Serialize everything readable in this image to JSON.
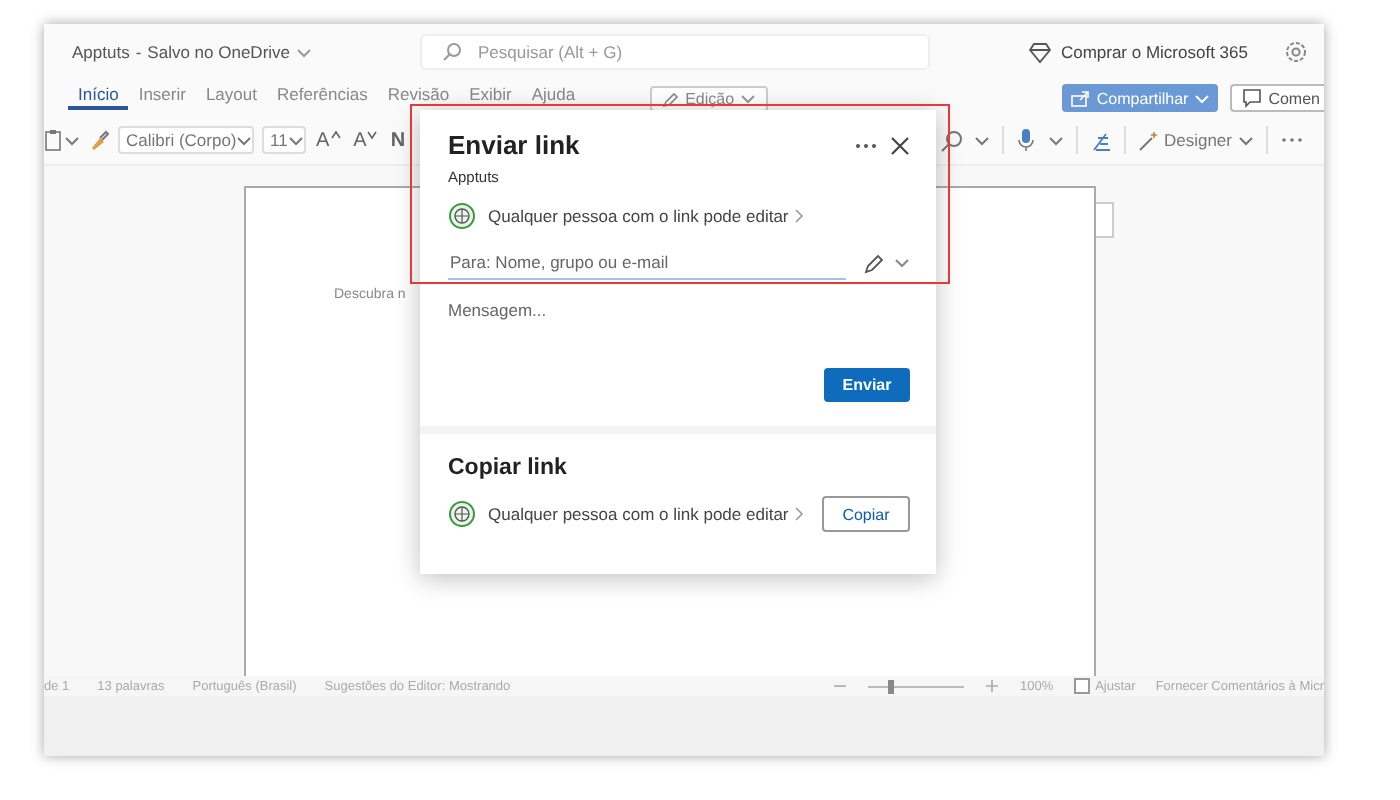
{
  "title_bar": {
    "document": "Apptuts",
    "separator": "-",
    "save_status": "Salvo no OneDrive",
    "search": {
      "placeholder": "Pesquisar (Alt + G)"
    },
    "buy": "Comprar o Microsoft 365"
  },
  "ribbon_tabs": [
    {
      "label": "Início",
      "selected": true
    },
    {
      "label": "Inserir",
      "selected": false
    },
    {
      "label": "Layout",
      "selected": false
    },
    {
      "label": "Referências",
      "selected": false
    },
    {
      "label": "Revisão",
      "selected": false
    },
    {
      "label": "Exibir",
      "selected": false
    },
    {
      "label": "Ajuda",
      "selected": false
    }
  ],
  "editing_mode": "Edição",
  "share_button": "Compartilhar",
  "comments_button": "Comen",
  "toolbar": {
    "font": "Calibri (Corpo)",
    "size": "11",
    "grow_font": "A",
    "shrink_font": "A",
    "bold": "N",
    "designer": "Designer"
  },
  "document": {
    "text": "Descubra n"
  },
  "status_bar": {
    "page": "de 1",
    "words": "13 palavras",
    "language": "Português (Brasil)",
    "editor": "Sugestões do Editor: Mostrando",
    "zoom": {
      "level": 0.2
    },
    "zoom_reading": "100%",
    "fit": {
      "label": "Ajustar",
      "checked": false
    },
    "feedback": "Fornecer Comentários à Micr"
  },
  "dialog": {
    "title": "Enviar link",
    "subtitle": "Apptuts",
    "permission": "Qualquer pessoa com o link pode editar",
    "to_field": {
      "placeholder": "Para: Nome, grupo ou e-mail"
    },
    "message": {
      "placeholder": "Mensagem..."
    },
    "send_button": "Enviar",
    "copy_title": "Copiar link",
    "copy_permission": "Qualquer pessoa com o link pode editar",
    "copy_button": "Copiar"
  }
}
